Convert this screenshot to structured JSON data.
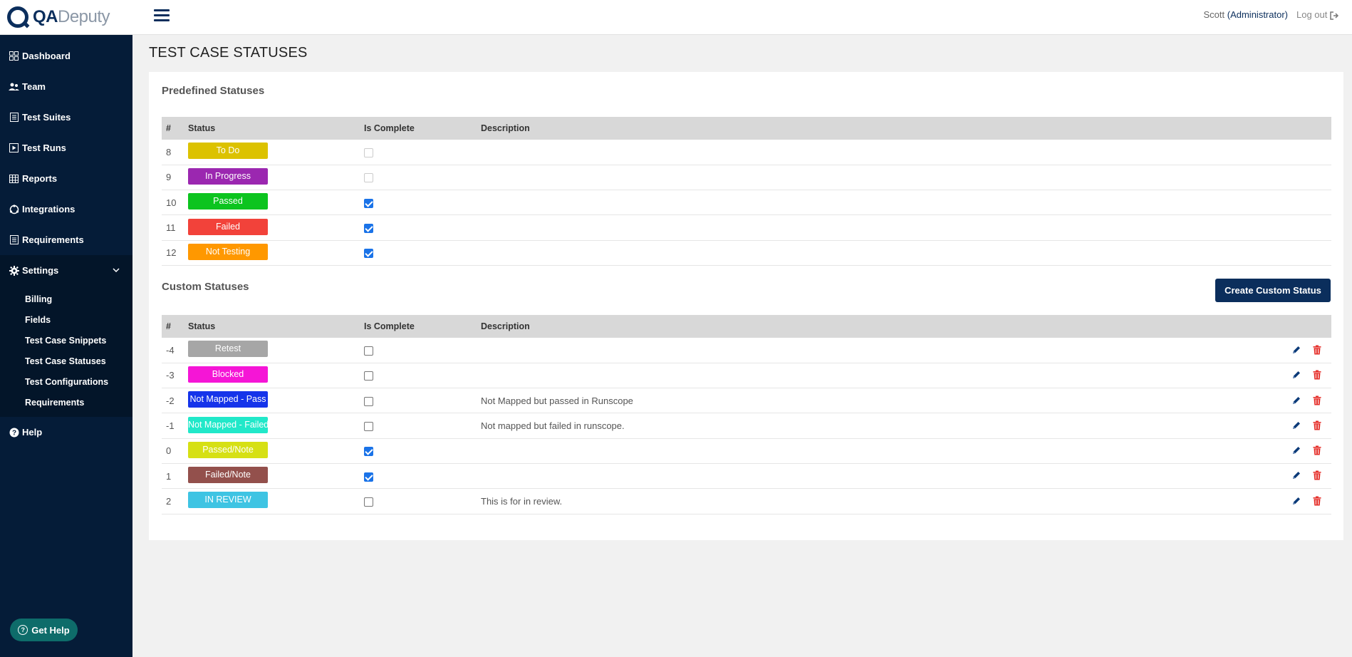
{
  "app": {
    "logo_qa": "QA",
    "logo_deputy": "Deputy"
  },
  "sidebar": {
    "items": [
      {
        "label": "Dashboard",
        "icon": "dashboard-icon"
      },
      {
        "label": "Team",
        "icon": "team-icon"
      },
      {
        "label": "Test Suites",
        "icon": "test-suites-icon"
      },
      {
        "label": "Test Runs",
        "icon": "test-runs-icon"
      },
      {
        "label": "Reports",
        "icon": "reports-icon"
      },
      {
        "label": "Integrations",
        "icon": "integrations-icon"
      },
      {
        "label": "Requirements",
        "icon": "requirements-icon"
      },
      {
        "label": "Settings",
        "icon": "gear-icon"
      }
    ],
    "settings_sub": [
      "Billing",
      "Fields",
      "Test Case Snippets",
      "Test Case Statuses",
      "Test Configurations",
      "Requirements"
    ],
    "help": "Help",
    "get_help": "Get Help"
  },
  "header": {
    "user": "Scott",
    "role": "(Administrator)",
    "logout": "Log out"
  },
  "page": {
    "title": "TEST CASE STATUSES"
  },
  "predefined": {
    "title": "Predefined Statuses",
    "columns": [
      "#",
      "Status",
      "Is Complete",
      "Description"
    ],
    "rows": [
      {
        "id": "8",
        "status": "To Do",
        "color": "#dcc200",
        "complete": false,
        "description": ""
      },
      {
        "id": "9",
        "status": "In Progress",
        "color": "#9b27b0",
        "complete": false,
        "description": ""
      },
      {
        "id": "10",
        "status": "Passed",
        "color": "#0cc41f",
        "complete": true,
        "description": ""
      },
      {
        "id": "11",
        "status": "Failed",
        "color": "#f2423a",
        "complete": true,
        "description": ""
      },
      {
        "id": "12",
        "status": "Not Testing",
        "color": "#ff9800",
        "complete": true,
        "description": ""
      }
    ]
  },
  "custom": {
    "title": "Custom Statuses",
    "create_button": "Create Custom Status",
    "columns": [
      "#",
      "Status",
      "Is Complete",
      "Description"
    ],
    "rows": [
      {
        "id": "-4",
        "status": "Retest",
        "color": "#a6a6a6",
        "complete": false,
        "description": ""
      },
      {
        "id": "-3",
        "status": "Blocked",
        "color": "#f515d6",
        "complete": false,
        "description": ""
      },
      {
        "id": "-2",
        "status": "Not Mapped - Pass",
        "color": "#1534ea",
        "complete": false,
        "description": "Not Mapped but passed in Runscope"
      },
      {
        "id": "-1",
        "status": "Not Mapped - Failed",
        "color": "#21e8c9",
        "complete": false,
        "description": "Not mapped but failed in runscope."
      },
      {
        "id": "0",
        "status": "Passed/Note",
        "color": "#d6e014",
        "complete": true,
        "description": ""
      },
      {
        "id": "1",
        "status": "Failed/Note",
        "color": "#93504c",
        "complete": true,
        "description": ""
      },
      {
        "id": "2",
        "status": "IN REVIEW",
        "color": "#3ec4e3",
        "complete": false,
        "description": "This is for in review."
      }
    ]
  }
}
